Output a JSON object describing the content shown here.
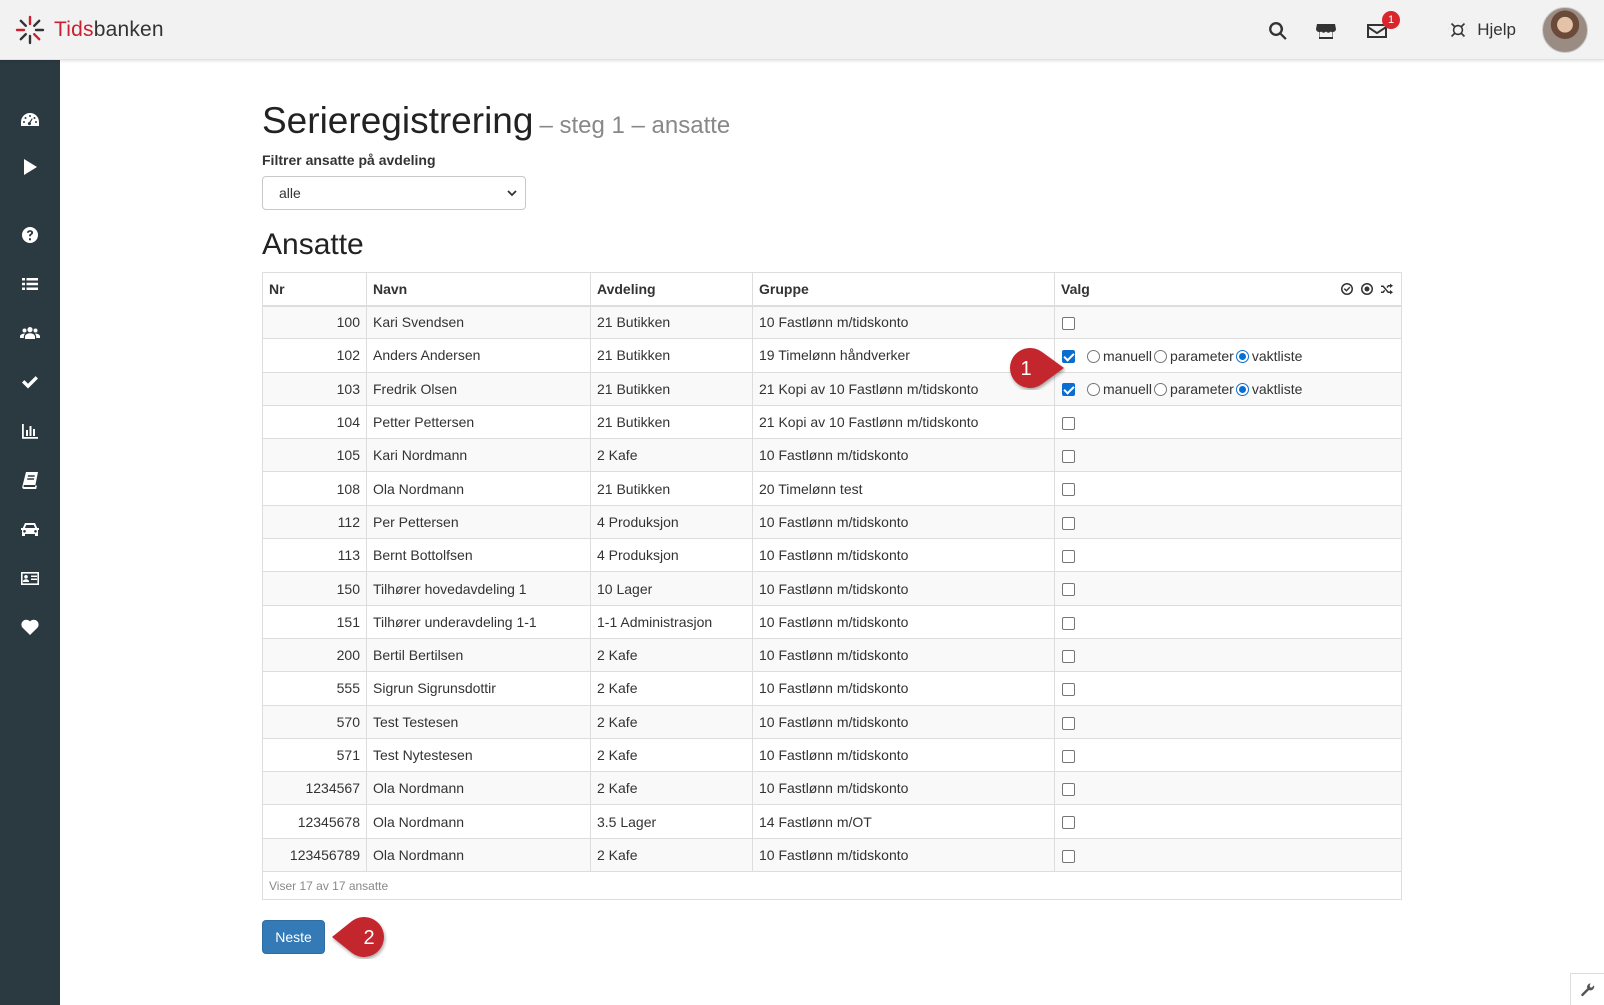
{
  "brand": {
    "name_part1": "Tids",
    "name_part2": "banken"
  },
  "topbar": {
    "icons": [
      "search-icon",
      "store-icon",
      "envelope-icon",
      "lifebuoy-icon"
    ],
    "mail_badge": "1",
    "help_label": "Hjelp"
  },
  "sidebar": {
    "icons": [
      "dashboard-icon",
      "play-icon",
      "question-icon",
      "list-icon",
      "users-icon",
      "check-icon",
      "bar-chart-icon",
      "book-icon",
      "car-icon",
      "id-card-icon",
      "heart-icon"
    ]
  },
  "page": {
    "title": "Serieregistrering",
    "subtitle": "– steg 1 – ansatte",
    "filter_label": "Filtrer ansatte på avdeling",
    "filter_value": "alle",
    "section_title": "Ansatte"
  },
  "table": {
    "headers": {
      "nr": "Nr",
      "navn": "Navn",
      "avdeling": "Avdeling",
      "gruppe": "Gruppe",
      "valg": "Valg"
    },
    "option_labels": {
      "manuell": "manuell",
      "parameter": "parameter",
      "vaktliste": "vaktliste"
    },
    "rows": [
      {
        "nr": "100",
        "navn": "Kari Svendsen",
        "avdeling": "21 Butikken",
        "gruppe": "10 Fastlønn m/tidskonto",
        "checked": false
      },
      {
        "nr": "102",
        "navn": "Anders Andersen",
        "avdeling": "21 Butikken",
        "gruppe": "19 Timelønn håndverker",
        "checked": true,
        "selected_option": "vaktliste"
      },
      {
        "nr": "103",
        "navn": "Fredrik Olsen",
        "avdeling": "21 Butikken",
        "gruppe": "21 Kopi av 10 Fastlønn m/tidskonto",
        "checked": true,
        "selected_option": "vaktliste"
      },
      {
        "nr": "104",
        "navn": "Petter Pettersen",
        "avdeling": "21 Butikken",
        "gruppe": "21 Kopi av 10 Fastlønn m/tidskonto",
        "checked": false
      },
      {
        "nr": "105",
        "navn": "Kari Nordmann",
        "avdeling": "2 Kafe",
        "gruppe": "10 Fastlønn m/tidskonto",
        "checked": false
      },
      {
        "nr": "108",
        "navn": "Ola Nordmann",
        "avdeling": "21 Butikken",
        "gruppe": "20 Timelønn test",
        "checked": false
      },
      {
        "nr": "112",
        "navn": "Per Pettersen",
        "avdeling": "4 Produksjon",
        "gruppe": "10 Fastlønn m/tidskonto",
        "checked": false
      },
      {
        "nr": "113",
        "navn": "Bernt Bottolfsen",
        "avdeling": "4 Produksjon",
        "gruppe": "10 Fastlønn m/tidskonto",
        "checked": false
      },
      {
        "nr": "150",
        "navn": "Tilhører hovedavdeling 1",
        "avdeling": "10 Lager",
        "gruppe": "10 Fastlønn m/tidskonto",
        "checked": false
      },
      {
        "nr": "151",
        "navn": "Tilhører underavdeling 1-1",
        "avdeling": "1-1 Administrasjon",
        "gruppe": "10 Fastlønn m/tidskonto",
        "checked": false
      },
      {
        "nr": "200",
        "navn": "Bertil Bertilsen",
        "avdeling": "2 Kafe",
        "gruppe": "10 Fastlønn m/tidskonto",
        "checked": false
      },
      {
        "nr": "555",
        "navn": "Sigrun Sigrunsdottir",
        "avdeling": "2 Kafe",
        "gruppe": "10 Fastlønn m/tidskonto",
        "checked": false
      },
      {
        "nr": "570",
        "navn": "Test Testesen",
        "avdeling": "2 Kafe",
        "gruppe": "10 Fastlønn m/tidskonto",
        "checked": false
      },
      {
        "nr": "571",
        "navn": "Test Nytestesen",
        "avdeling": "2 Kafe",
        "gruppe": "10 Fastlønn m/tidskonto",
        "checked": false
      },
      {
        "nr": "1234567",
        "navn": "Ola Nordmann",
        "avdeling": "2 Kafe",
        "gruppe": "10 Fastlønn m/tidskonto",
        "checked": false
      },
      {
        "nr": "12345678",
        "navn": "Ola Nordmann",
        "avdeling": "3.5 Lager",
        "gruppe": "14 Fastlønn m/OT",
        "checked": false
      },
      {
        "nr": "123456789",
        "navn": "Ola Nordmann",
        "avdeling": "2 Kafe",
        "gruppe": "10 Fastlønn m/tidskonto",
        "checked": false
      }
    ],
    "footer": "Viser 17 av 17 ansatte"
  },
  "next_button": "Neste",
  "annotations": {
    "marker_1": "1",
    "marker_2": "2"
  },
  "colors": {
    "sidebar": "#2b3941",
    "primary_button": "#337ab7",
    "marker": "#c4262f",
    "checkbox_checked": "#0a6ed1"
  }
}
